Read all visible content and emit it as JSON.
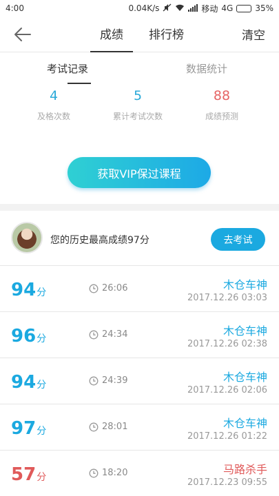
{
  "status_bar": {
    "time": "4:00",
    "speed": "0.04K/s",
    "carrier": "移动",
    "network": "4G",
    "battery": "35%",
    "battery_level": 0.35
  },
  "nav": {
    "tabs": [
      {
        "label": "成绩",
        "active": true
      },
      {
        "label": "排行榜",
        "active": false
      }
    ],
    "clear_label": "清空"
  },
  "sub_tabs": [
    {
      "label": "考试记录",
      "active": true
    },
    {
      "label": "数据统计",
      "active": false
    }
  ],
  "stats": [
    {
      "value": "4",
      "label": "及格次数"
    },
    {
      "value": "5",
      "label": "累计考试次数"
    },
    {
      "value": "88",
      "label": "成绩预测"
    }
  ],
  "vip_button": "获取VIP保过课程",
  "best": {
    "text": "您的历史最高成绩97分",
    "button": "去考试"
  },
  "records": [
    {
      "score": "94",
      "unit": "分",
      "duration": "26:06",
      "name": "木仓车神",
      "time": "2017.12.26  03:03",
      "passed": true
    },
    {
      "score": "96",
      "unit": "分",
      "duration": "24:34",
      "name": "木仓车神",
      "time": "2017.12.26  02:38",
      "passed": true
    },
    {
      "score": "94",
      "unit": "分",
      "duration": "24:39",
      "name": "木仓车神",
      "time": "2017.12.26  02:06",
      "passed": true
    },
    {
      "score": "97",
      "unit": "分",
      "duration": "28:01",
      "name": "木仓车神",
      "time": "2017.12.26  01:22",
      "passed": true
    },
    {
      "score": "57",
      "unit": "分",
      "duration": "18:20",
      "name": "马路杀手",
      "time": "2017.12.23  09:55",
      "passed": false
    }
  ],
  "colors": {
    "accent": "#1ba9e0",
    "fail": "#e05a5a",
    "muted": "#999999"
  },
  "icons": [
    "back-arrow-icon",
    "clock-icon",
    "wifi-icon",
    "signal-icon",
    "battery-icon",
    "mute-icon"
  ]
}
